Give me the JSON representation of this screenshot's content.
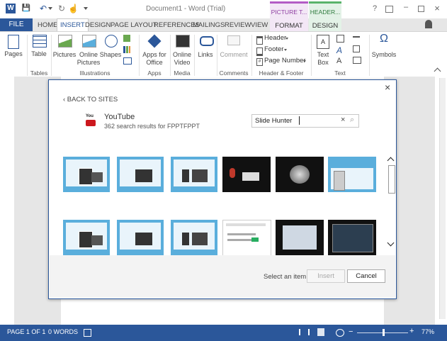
{
  "window": {
    "title": "Document1 - Word (Trial)",
    "contextual": [
      {
        "group": "PICTURE T...",
        "tab": "FORMAT"
      },
      {
        "group": "HEADER...",
        "tab": "DESIGN"
      }
    ],
    "help": "?"
  },
  "quick_access": {
    "save": "💾",
    "undo": "↶",
    "redo": "↻",
    "touch": "☝"
  },
  "tabs": [
    "FILE",
    "HOME",
    "INSERT",
    "DESIGN",
    "PAGE LAYOUT",
    "REFERENCES",
    "MAILINGS",
    "REVIEW",
    "VIEW"
  ],
  "ribbon": {
    "pages": "Pages",
    "table": "Table",
    "pictures": "Pictures",
    "online_pictures_1": "Online",
    "online_pictures_2": "Pictures",
    "shapes": "Shapes",
    "apps_for_office_1": "Apps for",
    "apps_for_office_2": "Office",
    "online_video_1": "Online",
    "online_video_2": "Video",
    "links": "Links",
    "comment": "Comment",
    "header": "Header",
    "footer": "Footer",
    "page_number": "Page Number",
    "text_box_1": "Text",
    "text_box_2": "Box",
    "symbols": "Symbols",
    "omega": "Ω",
    "groups": {
      "tables": "Tables",
      "illustrations": "Illustrations",
      "apps": "Apps",
      "media": "Media",
      "comments": "Comments",
      "header_footer": "Header & Footer",
      "text": "Text"
    }
  },
  "dialog": {
    "back": "‹ BACK TO SITES",
    "source_name": "YouTube",
    "source_logo": "You",
    "results": "362 search results for FPPTFPPT",
    "search_value": "Slide Hunter",
    "clear": "×",
    "search_icon": "⌕",
    "close": "×",
    "status": "Select an item.",
    "insert": "Insert",
    "cancel": "Cancel"
  },
  "statusbar": {
    "page": "PAGE 1 OF 1",
    "words": "0 WORDS",
    "zoom": "77%",
    "zoom_fraction": 0.52
  },
  "colors": {
    "accent": "#2b579a",
    "picture_tools": "#b35cc5",
    "header_tools": "#59b36b",
    "thumb_blue": "#5aaedc"
  }
}
